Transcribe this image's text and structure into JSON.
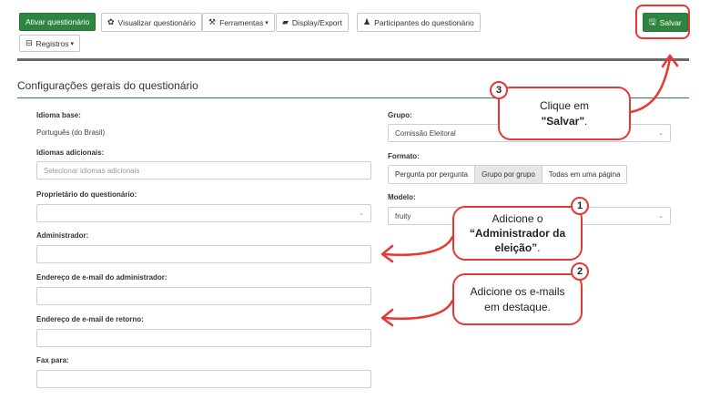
{
  "toolbar": {
    "activate_label": "Ativar questionário",
    "view_label": "Visualizar questionário",
    "tools_label": "Ferramentas",
    "display_export_label": "Display/Export",
    "participants_label": "Participantes do questionário",
    "records_label": "Registros",
    "save_label": "Salvar"
  },
  "section": {
    "title": "Configurações gerais do questionário"
  },
  "form": {
    "base_language_label": "Idioma base:",
    "base_language_value": "Português (do Brasil)",
    "additional_languages_label": "Idiomas adicionais:",
    "additional_languages_placeholder": "Selecionar idiomas adicionais",
    "owner_label": "Proprietário do questionário:",
    "owner_value": "",
    "admin_label": "Administrador:",
    "admin_value": "",
    "admin_email_label": "Endereço de e-mail do administrador:",
    "admin_email_value": "",
    "bounce_email_label": "Endereço de e-mail de retorno:",
    "bounce_email_value": "",
    "fax_label": "Fax para:",
    "fax_value": "",
    "group_label": "Grupo:",
    "group_value": "Comissão Eleitoral",
    "format_label": "Formato:",
    "format_options": [
      "Pergunta por pergunta",
      "Grupo por grupo",
      "Todas em uma página"
    ],
    "format_selected": "Grupo por grupo",
    "template_label": "Modelo:",
    "template_value": "fruity"
  },
  "annotations": {
    "step1": {
      "number": "1",
      "line1": "Adicione o",
      "line2": "“Administrador da",
      "line3": "eleição”",
      "line3_suffix": "."
    },
    "step2": {
      "number": "2",
      "line1": "Adicione os e-mails",
      "line2": "em destaque."
    },
    "step3": {
      "number": "3",
      "line1": "Clique em",
      "line2": "\"Salvar\"",
      "line2_suffix": "."
    }
  },
  "colors": {
    "primary_green": "#2e8540",
    "annotation_red": "#e53935"
  }
}
